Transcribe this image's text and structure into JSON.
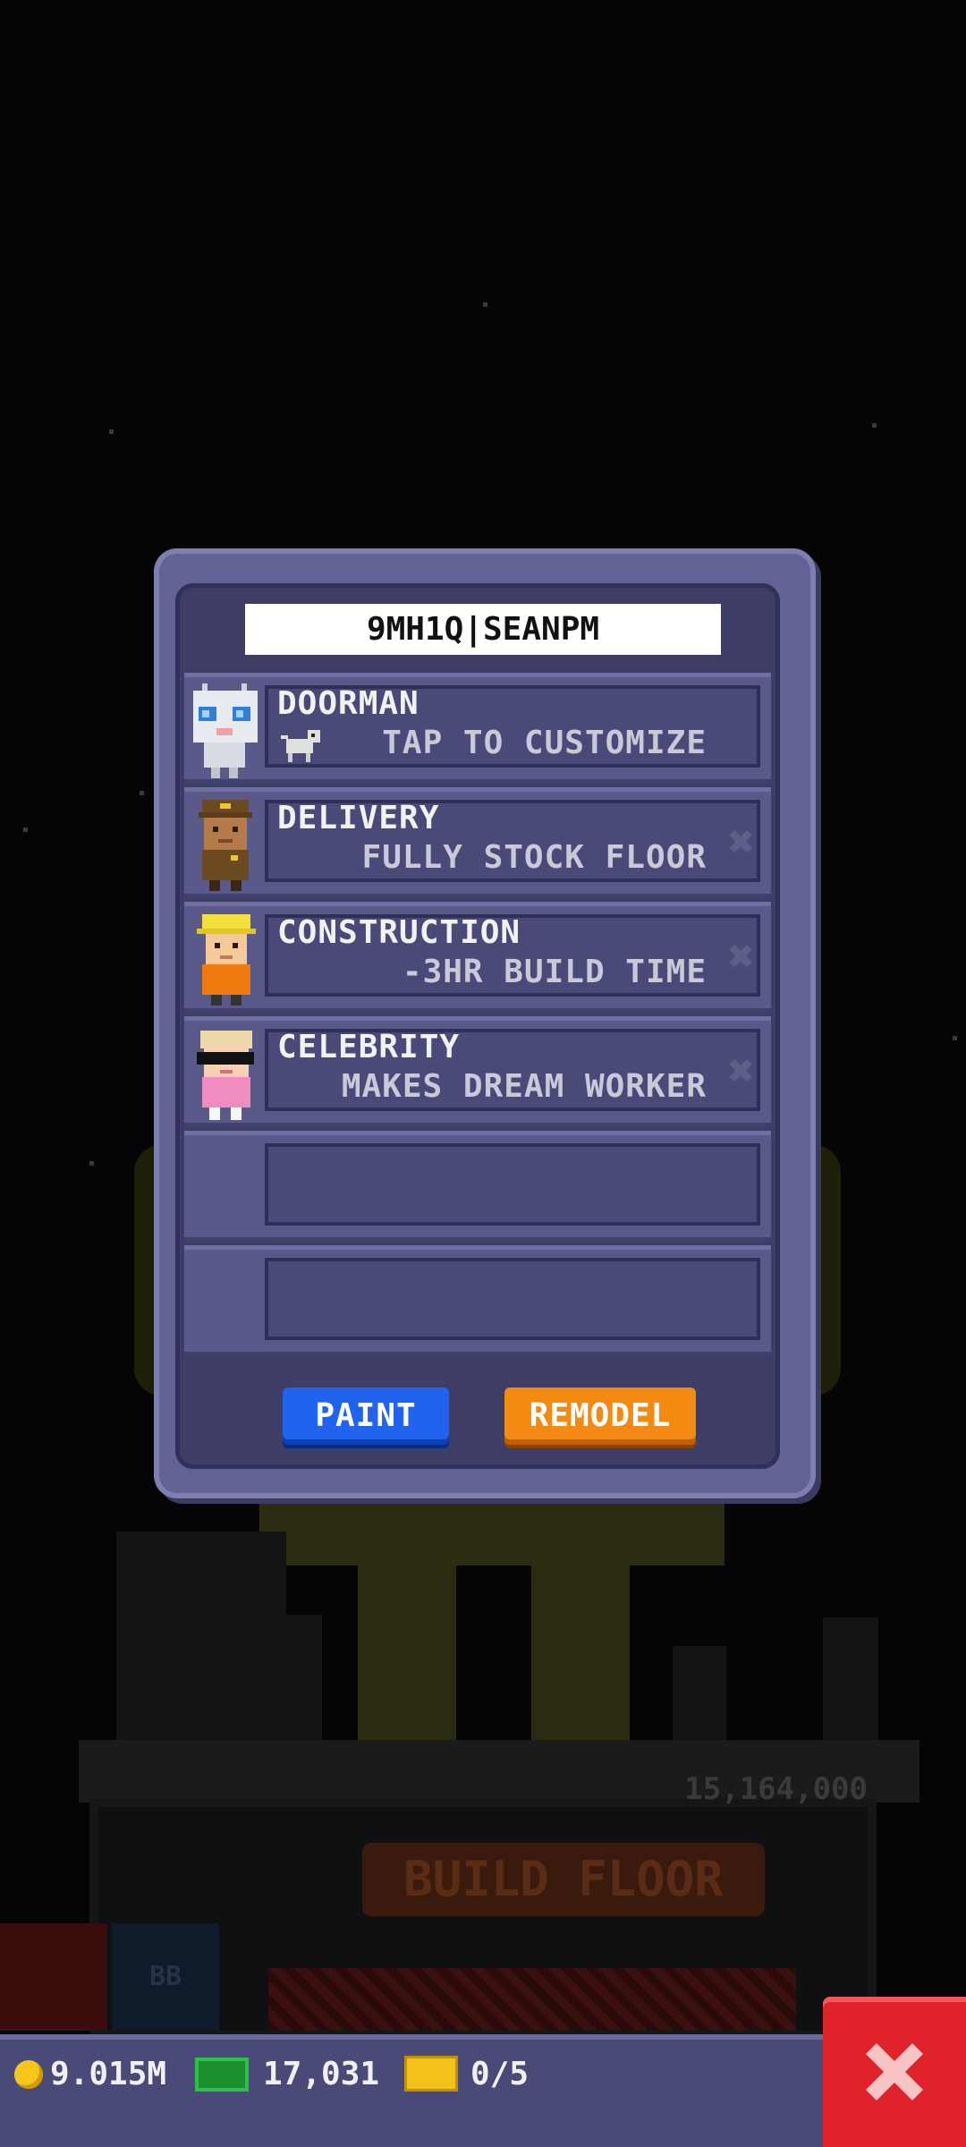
{
  "modal": {
    "tower_name": "9MH1Q|SEANPM",
    "slots": [
      {
        "title": "DOORMAN",
        "subtitle": "TAP TO CUSTOMIZE",
        "icon": "robot-doorman-icon",
        "has_remove": false
      },
      {
        "title": "DELIVERY",
        "subtitle": "FULLY STOCK FLOOR",
        "icon": "delivery-worker-icon",
        "has_remove": true
      },
      {
        "title": "CONSTRUCTION",
        "subtitle": "-3HR BUILD TIME",
        "icon": "construction-worker-icon",
        "has_remove": true
      },
      {
        "title": "CELEBRITY",
        "subtitle": "MAKES DREAM WORKER",
        "icon": "celebrity-icon",
        "has_remove": true
      },
      {
        "title": "",
        "subtitle": "",
        "icon": "",
        "has_remove": false
      },
      {
        "title": "",
        "subtitle": "",
        "icon": "",
        "has_remove": false
      }
    ],
    "paint_label": "PAINT",
    "remodel_label": "REMODEL",
    "remove_glyph": "✖"
  },
  "background": {
    "floor_cost": "15,164,000",
    "build_floor_label": "BUILD FLOOR",
    "bb_label": "BB"
  },
  "hud": {
    "coins": "9.015M",
    "bux": "17,031",
    "tickets": "0/5"
  },
  "colors": {
    "paint": "#1f63ef",
    "remodel": "#f38a12",
    "close": "#e0232a"
  }
}
